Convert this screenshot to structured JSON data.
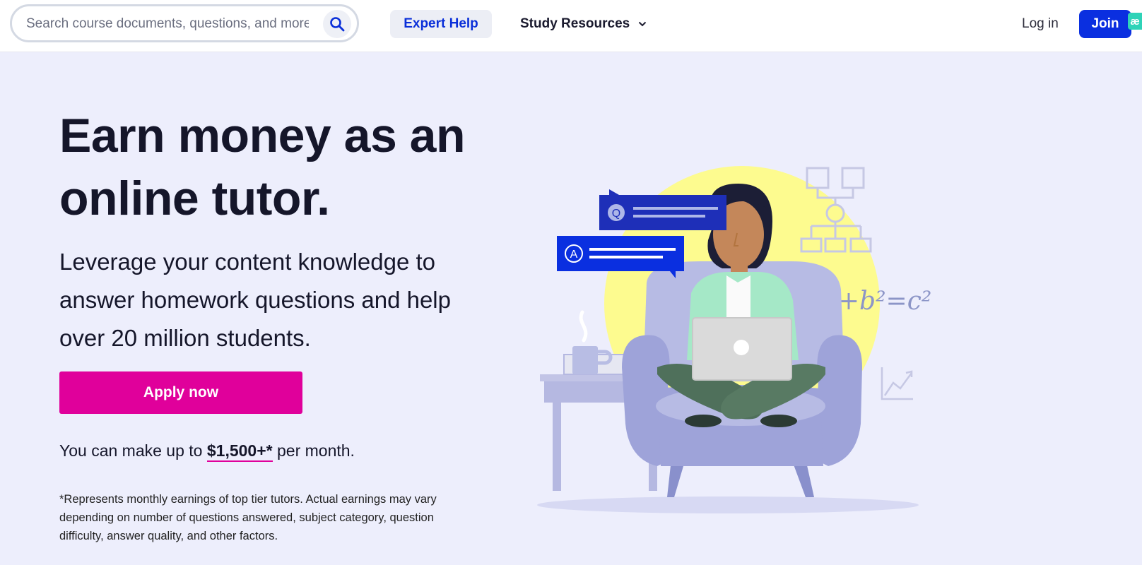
{
  "header": {
    "search": {
      "placeholder": "Search course documents, questions, and more"
    },
    "expert_help": "Expert Help",
    "study_resources": "Study Resources",
    "login": "Log in",
    "join": "Join",
    "extension_badge": "æ"
  },
  "hero": {
    "title": "Earn money as an online tutor.",
    "subtitle": "Leverage your content knowledge to answer homework questions and help over 20 million students.",
    "apply": "Apply now",
    "earn_prefix": "You can make up to ",
    "earn_amount": "$1,500+*",
    "earn_suffix": " per month.",
    "disclaimer": "*Represents monthly earnings of top tier tutors. Actual earnings may vary depending on number of questions answered, subject category, question difficulty, answer quality, and other factors."
  },
  "illustration": {
    "bubble_q": "Q",
    "bubble_a": "A",
    "formula": "a²+b²=c²"
  },
  "colors": {
    "page_bg": "#edeefc",
    "brand_blue": "#0a2fe0",
    "apply_pink": "#e0009b",
    "sun_yellow": "#fdfb8f",
    "chair": "#9ea3d9"
  },
  "icons": [
    "search-icon",
    "chevron-down-icon"
  ]
}
